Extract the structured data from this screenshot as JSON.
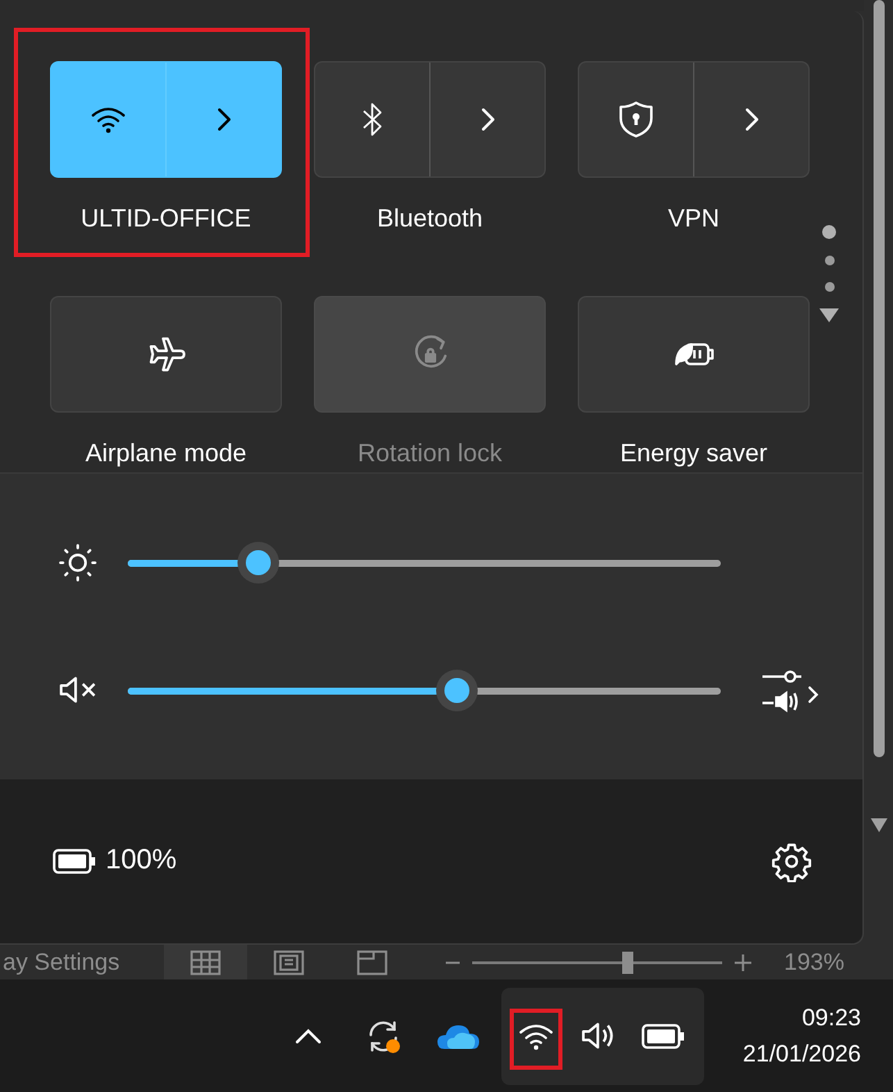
{
  "quick_settings": {
    "tiles": [
      {
        "kind": "split",
        "label": "ULTID-OFFICE",
        "on": true,
        "disabled": false,
        "highlighted": true
      },
      {
        "kind": "split",
        "label": "Bluetooth",
        "on": false,
        "disabled": false,
        "highlighted": false
      },
      {
        "kind": "split",
        "label": "VPN",
        "on": false,
        "disabled": false,
        "highlighted": false
      },
      {
        "kind": "toggle",
        "label": "Airplane mode",
        "on": false,
        "disabled": false,
        "highlighted": false
      },
      {
        "kind": "toggle",
        "label": "Rotation lock",
        "on": false,
        "disabled": true,
        "highlighted": false
      },
      {
        "kind": "toggle",
        "label": "Energy saver",
        "on": false,
        "disabled": false,
        "highlighted": false
      }
    ],
    "pages": [
      {
        "selected": true
      },
      {
        "selected": false
      },
      {
        "selected": false
      }
    ],
    "sliders": [
      {
        "kind": "brightness",
        "level": 0.22
      },
      {
        "kind": "volume",
        "muted": true,
        "level": 0.555
      }
    ],
    "battery": "100%"
  },
  "app_status_bar": {
    "text": "ay Settings",
    "zoom_slider": {
      "level": 0.62
    },
    "zoom": "193%"
  },
  "taskbar": {
    "wifi_highlighted": true,
    "time": "09:23",
    "date": "21/01/2026"
  }
}
